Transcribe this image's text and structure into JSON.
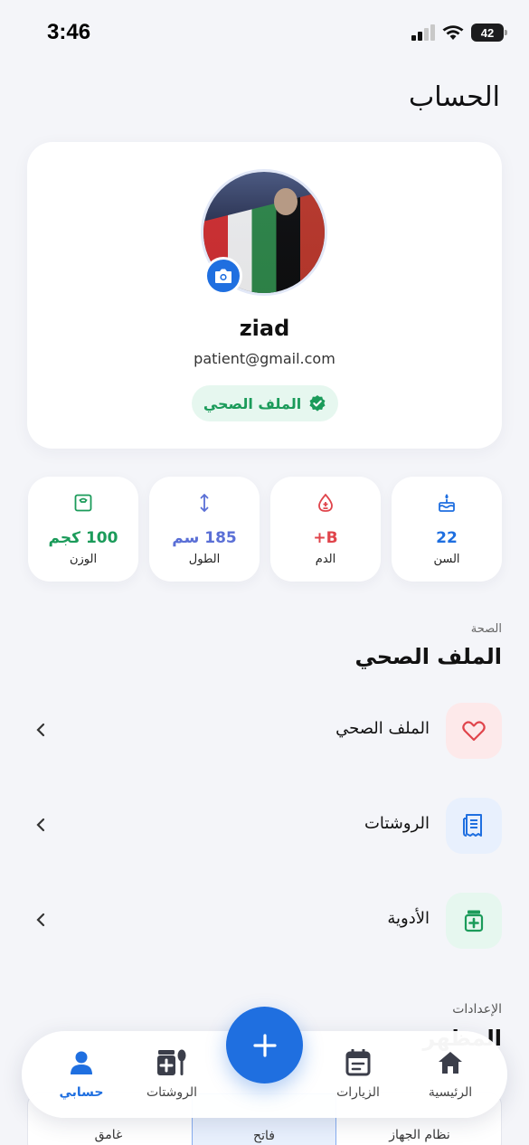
{
  "status_bar": {
    "time": "3:46",
    "battery": "42"
  },
  "header": {
    "title": "الحساب"
  },
  "profile": {
    "name": "ziad",
    "email": "patient@gmail.com",
    "badge_label": "الملف الصحي"
  },
  "stats": [
    {
      "value": "22",
      "label": "السن",
      "color": "#1f6fe0",
      "icon": "cake-icon"
    },
    {
      "value": "B+",
      "label": "الدم",
      "color": "#e0444b",
      "icon": "blood-drop-icon"
    },
    {
      "value": "185 سم",
      "label": "الطول",
      "color": "#5a6fd6",
      "icon": "height-arrows-icon"
    },
    {
      "value": "100 كجم",
      "label": "الوزن",
      "color": "#1b9b5a",
      "icon": "scale-icon"
    }
  ],
  "health_section": {
    "kicker": "الصحة",
    "title": "الملف الصحي",
    "items": [
      {
        "label": "الملف الصحي",
        "icon": "heart-icon",
        "bg": "#fde9ea",
        "color": "#e0444b"
      },
      {
        "label": "الروشتات",
        "icon": "receipt-icon",
        "bg": "#e8f0fd",
        "color": "#1f6fe0"
      },
      {
        "label": "الأدوية",
        "icon": "medicine-icon",
        "bg": "#e6f7ef",
        "color": "#1b9b5a"
      }
    ]
  },
  "settings_section": {
    "kicker": "الإعدادات",
    "title": "المظهر",
    "theme_options": [
      "نظام الجهاز",
      "فاتح",
      "غامق"
    ]
  },
  "tabbar": {
    "items": [
      {
        "label": "الرئيسية",
        "icon": "home-icon"
      },
      {
        "label": "الزيارات",
        "icon": "calendar-icon"
      },
      {
        "label": "الروشتات",
        "icon": "prescription-icon"
      },
      {
        "label": "حسابي",
        "icon": "person-icon",
        "active": true
      }
    ],
    "fab_icon": "plus-icon"
  }
}
